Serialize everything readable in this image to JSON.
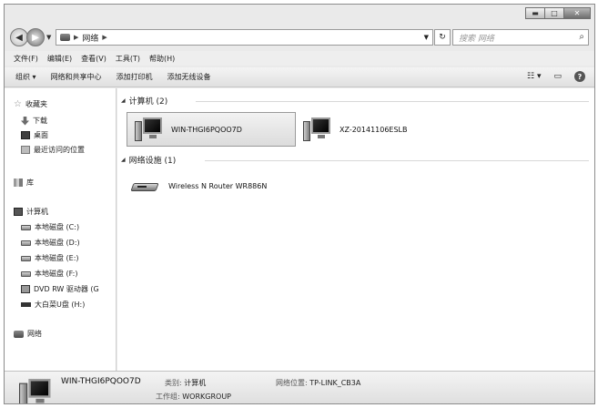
{
  "address": {
    "segments": [
      "网络"
    ],
    "search_placeholder": "搜索 网络"
  },
  "menu": [
    "文件(F)",
    "编辑(E)",
    "查看(V)",
    "工具(T)",
    "帮助(H)"
  ],
  "toolbar": {
    "items": [
      "组织 ▾",
      "网络和共享中心",
      "添加打印机",
      "添加无线设备"
    ]
  },
  "sidebar": {
    "favorites": "收藏夹",
    "downloads": "下载",
    "desktop": "桌面",
    "recent": "最近访问的位置",
    "libraries": "库",
    "computer": "计算机",
    "drives": [
      "本地磁盘 (C:)",
      "本地磁盘 (D:)",
      "本地磁盘 (E:)",
      "本地磁盘 (F:)",
      "DVD RW 驱动器 (G",
      "大白菜U盘 (H:)"
    ],
    "network": "网络"
  },
  "content": {
    "computers_header": "计算机 (2)",
    "computers": [
      "WIN-THGI6PQOO7D",
      "XZ-20141106ESLB"
    ],
    "devices_header": "网络设施 (1)",
    "devices": [
      "Wireless N Router WR886N"
    ]
  },
  "details": {
    "name": "WIN-THGI6PQOO7D",
    "category_label": "类别:",
    "category_value": "计算机",
    "workgroup_label": "工作组:",
    "workgroup_value": "WORKGROUP",
    "location_label": "网络位置:",
    "location_value": "TP-LINK_CB3A"
  }
}
